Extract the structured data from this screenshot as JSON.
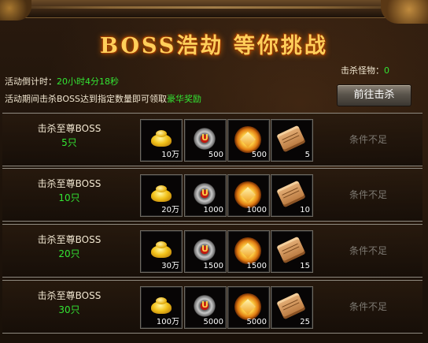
{
  "title": "BOSS浩劫 等你挑战",
  "countdown": {
    "label": "活动倒计时：",
    "value": "20小时4分18秒"
  },
  "notice": {
    "text": "活动期间击杀BOSS达到指定数量即可领取",
    "highlight": "豪华奖励"
  },
  "kill_count": {
    "label": "击杀怪物：",
    "value": "0"
  },
  "goto_button": "前往击杀",
  "rows": [
    {
      "label": "击杀至尊BOSS",
      "count": "5只",
      "rewards": [
        {
          "icon": "gold-ingot-icon",
          "qty": "10万"
        },
        {
          "icon": "rune-badge-icon",
          "qty": "500"
        },
        {
          "icon": "fire-crystal-icon",
          "qty": "500"
        },
        {
          "icon": "scroll-icon",
          "qty": "5"
        }
      ],
      "status": "条件不足"
    },
    {
      "label": "击杀至尊BOSS",
      "count": "10只",
      "rewards": [
        {
          "icon": "gold-ingot-icon",
          "qty": "20万"
        },
        {
          "icon": "rune-badge-icon",
          "qty": "1000"
        },
        {
          "icon": "fire-crystal-icon",
          "qty": "1000"
        },
        {
          "icon": "scroll-icon",
          "qty": "10"
        }
      ],
      "status": "条件不足"
    },
    {
      "label": "击杀至尊BOSS",
      "count": "20只",
      "rewards": [
        {
          "icon": "gold-ingot-icon",
          "qty": "30万"
        },
        {
          "icon": "rune-badge-icon",
          "qty": "1500"
        },
        {
          "icon": "fire-crystal-icon",
          "qty": "1500"
        },
        {
          "icon": "scroll-icon",
          "qty": "15"
        }
      ],
      "status": "条件不足"
    },
    {
      "label": "击杀至尊BOSS",
      "count": "30只",
      "rewards": [
        {
          "icon": "gold-ingot-icon",
          "qty": "100万"
        },
        {
          "icon": "rune-badge-icon",
          "qty": "5000"
        },
        {
          "icon": "fire-crystal-icon",
          "qty": "5000"
        },
        {
          "icon": "scroll-icon",
          "qty": "25"
        }
      ],
      "status": "条件不足"
    }
  ],
  "colors": {
    "title": "#ffcf5a",
    "highlight_green": "#33e533",
    "status_gray": "#7d7972"
  }
}
